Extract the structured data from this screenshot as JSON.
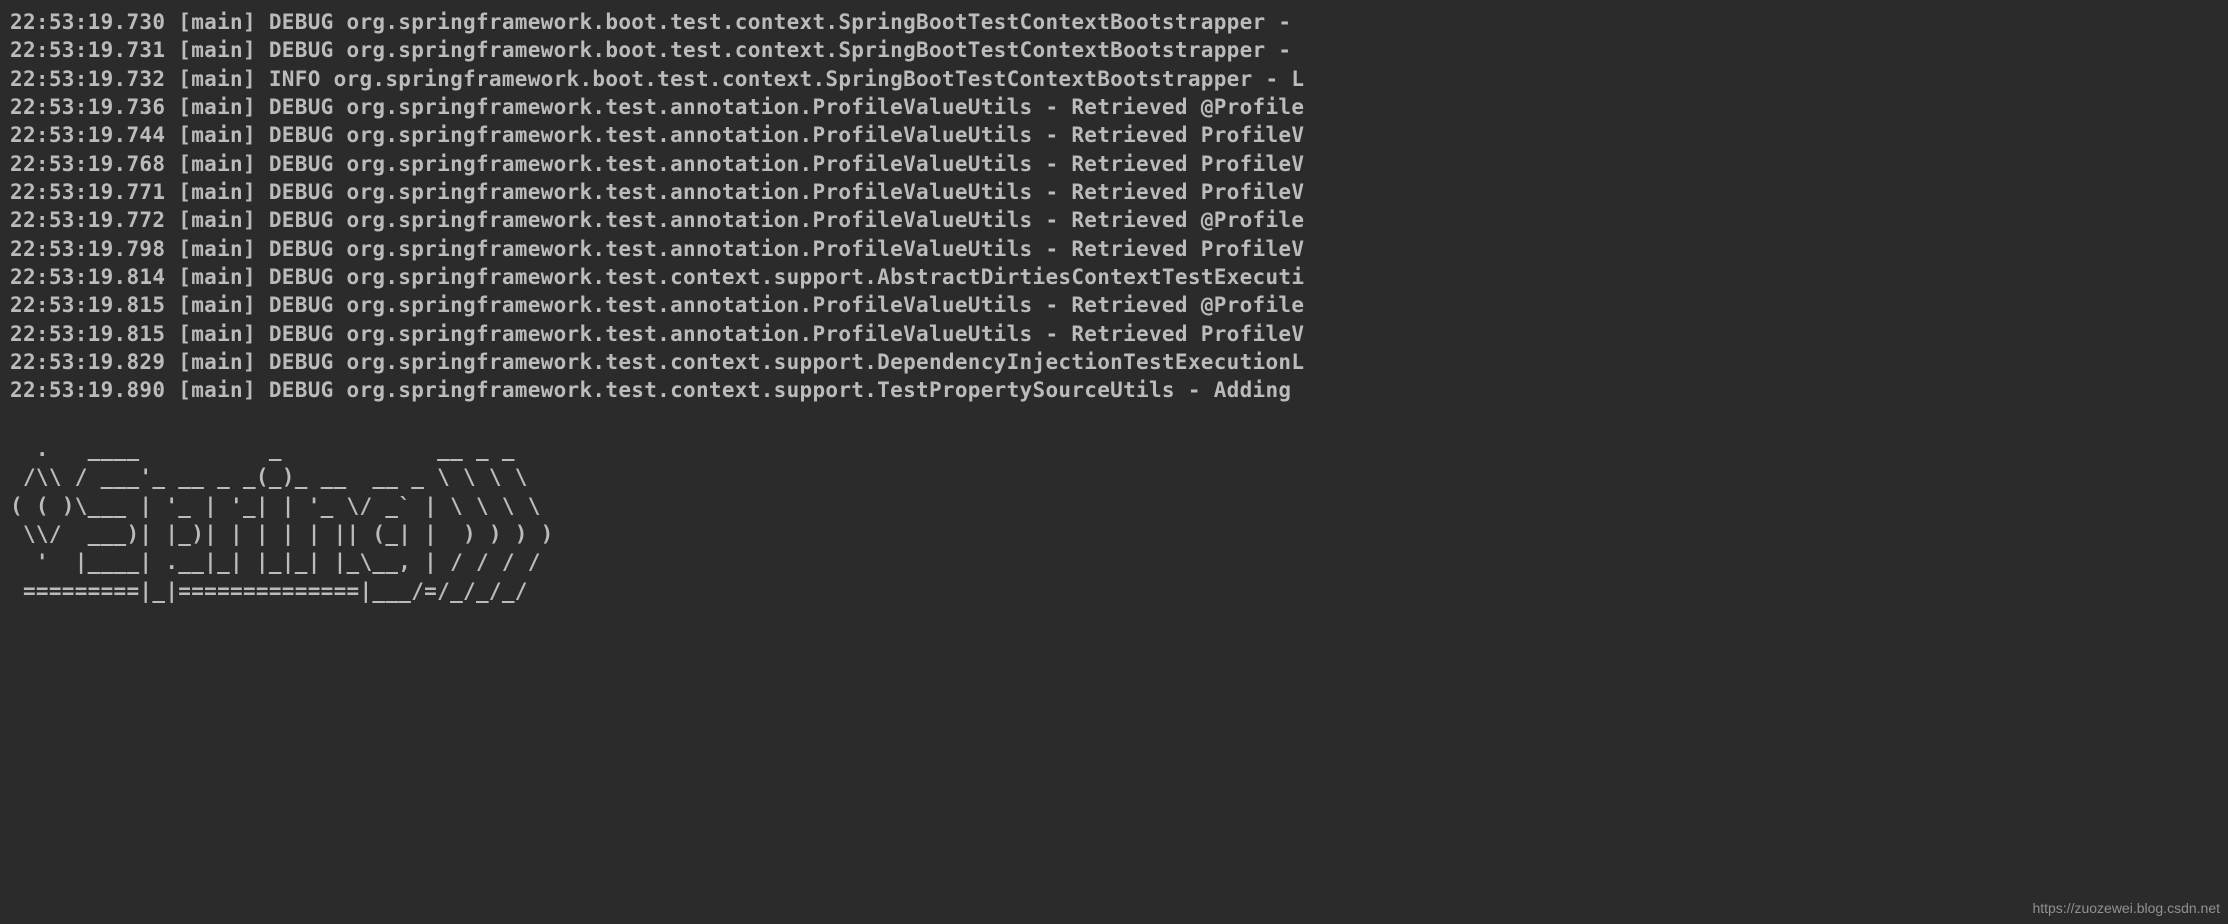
{
  "logs": [
    {
      "time": "22:53:19.730",
      "thread": "[main]",
      "level": "DEBUG",
      "msg": "org.springframework.boot.test.context.SpringBootTestContextBootstrapper -"
    },
    {
      "time": "22:53:19.731",
      "thread": "[main]",
      "level": "DEBUG",
      "msg": "org.springframework.boot.test.context.SpringBootTestContextBootstrapper -"
    },
    {
      "time": "22:53:19.732",
      "thread": "[main]",
      "level": "INFO",
      "msg": "org.springframework.boot.test.context.SpringBootTestContextBootstrapper - L"
    },
    {
      "time": "22:53:19.736",
      "thread": "[main]",
      "level": "DEBUG",
      "msg": "org.springframework.test.annotation.ProfileValueUtils - Retrieved @Profile"
    },
    {
      "time": "22:53:19.744",
      "thread": "[main]",
      "level": "DEBUG",
      "msg": "org.springframework.test.annotation.ProfileValueUtils - Retrieved ProfileV"
    },
    {
      "time": "22:53:19.768",
      "thread": "[main]",
      "level": "DEBUG",
      "msg": "org.springframework.test.annotation.ProfileValueUtils - Retrieved ProfileV"
    },
    {
      "time": "22:53:19.771",
      "thread": "[main]",
      "level": "DEBUG",
      "msg": "org.springframework.test.annotation.ProfileValueUtils - Retrieved ProfileV"
    },
    {
      "time": "22:53:19.772",
      "thread": "[main]",
      "level": "DEBUG",
      "msg": "org.springframework.test.annotation.ProfileValueUtils - Retrieved @Profile"
    },
    {
      "time": "22:53:19.798",
      "thread": "[main]",
      "level": "DEBUG",
      "msg": "org.springframework.test.annotation.ProfileValueUtils - Retrieved ProfileV"
    },
    {
      "time": "22:53:19.814",
      "thread": "[main]",
      "level": "DEBUG",
      "msg": "org.springframework.test.context.support.AbstractDirtiesContextTestExecuti"
    },
    {
      "time": "22:53:19.815",
      "thread": "[main]",
      "level": "DEBUG",
      "msg": "org.springframework.test.annotation.ProfileValueUtils - Retrieved @Profile"
    },
    {
      "time": "22:53:19.815",
      "thread": "[main]",
      "level": "DEBUG",
      "msg": "org.springframework.test.annotation.ProfileValueUtils - Retrieved ProfileV"
    },
    {
      "time": "22:53:19.829",
      "thread": "[main]",
      "level": "DEBUG",
      "msg": "org.springframework.test.context.support.DependencyInjectionTestExecutionL"
    },
    {
      "time": "22:53:19.890",
      "thread": "[main]",
      "level": "DEBUG",
      "msg": "org.springframework.test.context.support.TestPropertySourceUtils - Adding"
    }
  ],
  "banner": "  .   ____          _            __ _ _\n /\\\\ / ___'_ __ _ _(_)_ __  __ _ \\ \\ \\ \\\n( ( )\\___ | '_ | '_| | '_ \\/ _` | \\ \\ \\ \\\n \\\\/  ___)| |_)| | | | | || (_| |  ) ) ) )\n  '  |____| .__|_| |_|_| |_\\__, | / / / /\n =========|_|==============|___/=/_/_/_/",
  "watermark": "https://zuozewei.blog.csdn.net"
}
